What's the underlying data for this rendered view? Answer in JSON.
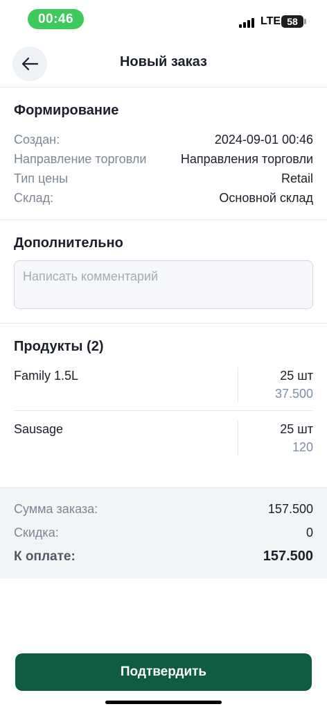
{
  "status_bar": {
    "time": "00:46",
    "network": "LTE",
    "battery": "58"
  },
  "header": {
    "title": "Новый заказ"
  },
  "formation": {
    "title": "Формирование",
    "rows": [
      {
        "label": "Создан:",
        "value": "2024-09-01 00:46"
      },
      {
        "label": "Направление торговли",
        "value": "Направления торговли"
      },
      {
        "label": "Тип цены",
        "value": "Retail"
      },
      {
        "label": "Склад:",
        "value": "Основной склад"
      }
    ]
  },
  "additional": {
    "title": "Дополнительно",
    "comment_placeholder": "Написать комментарий",
    "comment_value": ""
  },
  "products": {
    "title": "Продукты (2)",
    "items": [
      {
        "name": "Family 1.5L",
        "qty": "25 шт",
        "price": "37.500"
      },
      {
        "name": "Sausage",
        "qty": "25 шт",
        "price": "120"
      }
    ]
  },
  "summary": {
    "order_sum_label": "Сумма заказа:",
    "order_sum_value": "157.500",
    "discount_label": "Скидка:",
    "discount_value": "0",
    "to_pay_label": "К оплате:",
    "to_pay_value": "157.500"
  },
  "actions": {
    "confirm_label": "Подтвердить"
  },
  "colors": {
    "accent": "#0f5c42",
    "time_pill": "#3ccb5a",
    "muted_text": "#7c8796",
    "price_text": "#7c8fa8"
  },
  "icons": {
    "back": "arrow-left-icon"
  }
}
